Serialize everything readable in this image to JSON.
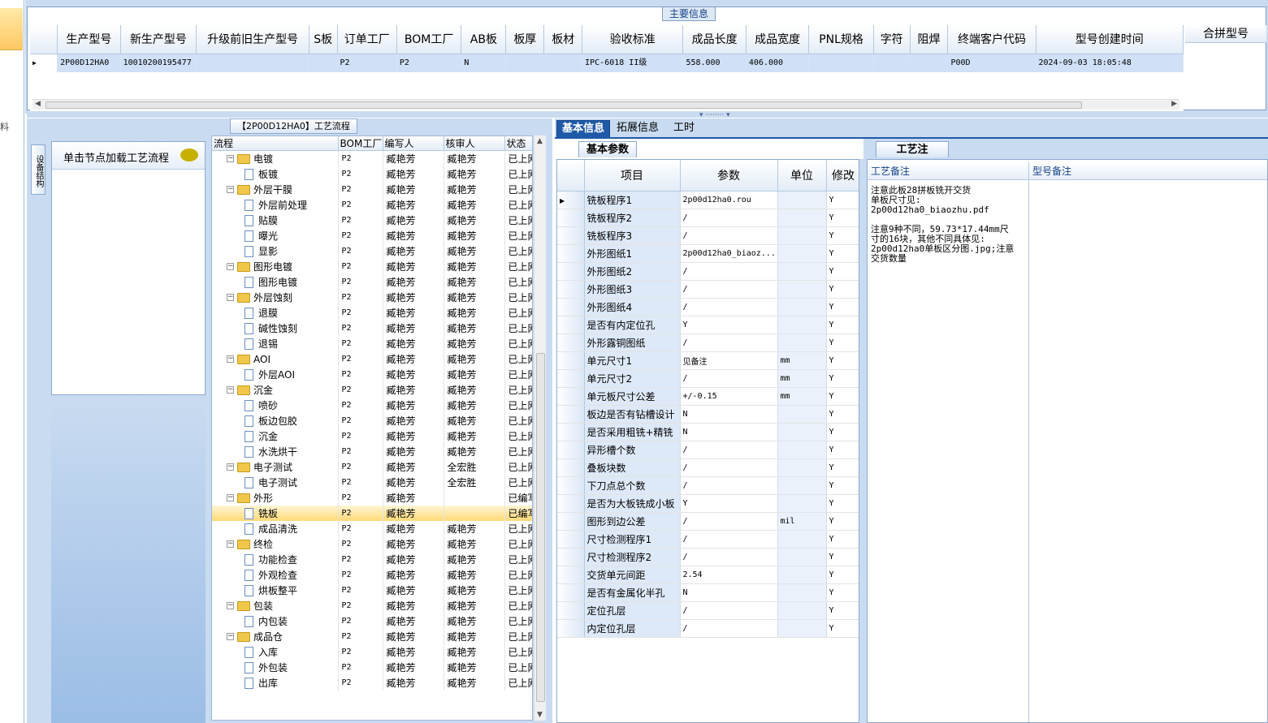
{
  "main_info": {
    "title": "主要信息",
    "columns": [
      "生产型号",
      "新生产型号",
      "升级前旧生产型号",
      "S板",
      "订单工厂",
      "BOM工厂",
      "AB板",
      "板厚",
      "板材",
      "验收标准",
      "成品长度",
      "成品宽度",
      "PNL规格",
      "字符",
      "阻焊",
      "终端客户代码",
      "型号创建时间"
    ],
    "row": [
      "2P00D12HA0",
      "10010200195477",
      "",
      "",
      "P2",
      "P2",
      "N",
      "",
      "",
      "IPC-6018 II级",
      "558.000",
      "406.000",
      "",
      "",
      "",
      "P00D",
      "2024-09-03 18:05:48"
    ],
    "merge_header": "合拼型号"
  },
  "left_strip": {
    "char": "料"
  },
  "side": {
    "vtab_label": "设备结构",
    "hint": "单击节点加载工艺流程"
  },
  "tree": {
    "title": "【2P00D12HA0】工艺流程",
    "columns": [
      "流程",
      "BOM工厂",
      "编写人",
      "核审人",
      "状态"
    ],
    "rows": [
      {
        "level": 0,
        "name": "电镀",
        "bom": "P2",
        "writer": "臧艳芳",
        "reviewer": "臧艳芳",
        "status": "已上网"
      },
      {
        "level": 1,
        "name": "板镀",
        "bom": "P2",
        "writer": "臧艳芳",
        "reviewer": "臧艳芳",
        "status": "已上网"
      },
      {
        "level": 0,
        "name": "外层干膜",
        "bom": "P2",
        "writer": "臧艳芳",
        "reviewer": "臧艳芳",
        "status": "已上网"
      },
      {
        "level": 1,
        "name": "外层前处理",
        "bom": "P2",
        "writer": "臧艳芳",
        "reviewer": "臧艳芳",
        "status": "已上网"
      },
      {
        "level": 1,
        "name": "贴膜",
        "bom": "P2",
        "writer": "臧艳芳",
        "reviewer": "臧艳芳",
        "status": "已上网"
      },
      {
        "level": 1,
        "name": "曝光",
        "bom": "P2",
        "writer": "臧艳芳",
        "reviewer": "臧艳芳",
        "status": "已上网"
      },
      {
        "level": 1,
        "name": "显影",
        "bom": "P2",
        "writer": "臧艳芳",
        "reviewer": "臧艳芳",
        "status": "已上网"
      },
      {
        "level": 0,
        "name": "图形电镀",
        "bom": "P2",
        "writer": "臧艳芳",
        "reviewer": "臧艳芳",
        "status": "已上网"
      },
      {
        "level": 1,
        "name": "图形电镀",
        "bom": "P2",
        "writer": "臧艳芳",
        "reviewer": "臧艳芳",
        "status": "已上网"
      },
      {
        "level": 0,
        "name": "外层蚀刻",
        "bom": "P2",
        "writer": "臧艳芳",
        "reviewer": "臧艳芳",
        "status": "已上网"
      },
      {
        "level": 1,
        "name": "退膜",
        "bom": "P2",
        "writer": "臧艳芳",
        "reviewer": "臧艳芳",
        "status": "已上网"
      },
      {
        "level": 1,
        "name": "碱性蚀刻",
        "bom": "P2",
        "writer": "臧艳芳",
        "reviewer": "臧艳芳",
        "status": "已上网"
      },
      {
        "level": 1,
        "name": "退锡",
        "bom": "P2",
        "writer": "臧艳芳",
        "reviewer": "臧艳芳",
        "status": "已上网"
      },
      {
        "level": 0,
        "name": "AOI",
        "bom": "P2",
        "writer": "臧艳芳",
        "reviewer": "臧艳芳",
        "status": "已上网"
      },
      {
        "level": 1,
        "name": "外层AOI",
        "bom": "P2",
        "writer": "臧艳芳",
        "reviewer": "臧艳芳",
        "status": "已上网"
      },
      {
        "level": 0,
        "name": "沉金",
        "bom": "P2",
        "writer": "臧艳芳",
        "reviewer": "臧艳芳",
        "status": "已上网"
      },
      {
        "level": 1,
        "name": "喷砂",
        "bom": "P2",
        "writer": "臧艳芳",
        "reviewer": "臧艳芳",
        "status": "已上网"
      },
      {
        "level": 1,
        "name": "板边包胶",
        "bom": "P2",
        "writer": "臧艳芳",
        "reviewer": "臧艳芳",
        "status": "已上网"
      },
      {
        "level": 1,
        "name": "沉金",
        "bom": "P2",
        "writer": "臧艳芳",
        "reviewer": "臧艳芳",
        "status": "已上网"
      },
      {
        "level": 1,
        "name": "水洗烘干",
        "bom": "P2",
        "writer": "臧艳芳",
        "reviewer": "臧艳芳",
        "status": "已上网"
      },
      {
        "level": 0,
        "name": "电子测试",
        "bom": "P2",
        "writer": "臧艳芳",
        "reviewer": "全宏胜",
        "status": "已上网"
      },
      {
        "level": 1,
        "name": "电子测试",
        "bom": "P2",
        "writer": "臧艳芳",
        "reviewer": "全宏胜",
        "status": "已上网"
      },
      {
        "level": 0,
        "name": "外形",
        "bom": "P2",
        "writer": "臧艳芳",
        "reviewer": "",
        "status": "已编写"
      },
      {
        "level": 1,
        "name": "铣板",
        "bom": "P2",
        "writer": "臧艳芳",
        "reviewer": "",
        "status": "已编写",
        "selected": true
      },
      {
        "level": 1,
        "name": "成品清洗",
        "bom": "P2",
        "writer": "臧艳芳",
        "reviewer": "臧艳芳",
        "status": "已上网"
      },
      {
        "level": 0,
        "name": "终检",
        "bom": "P2",
        "writer": "臧艳芳",
        "reviewer": "臧艳芳",
        "status": "已上网"
      },
      {
        "level": 1,
        "name": "功能检查",
        "bom": "P2",
        "writer": "臧艳芳",
        "reviewer": "臧艳芳",
        "status": "已上网"
      },
      {
        "level": 1,
        "name": "外观检查",
        "bom": "P2",
        "writer": "臧艳芳",
        "reviewer": "臧艳芳",
        "status": "已上网"
      },
      {
        "level": 1,
        "name": "烘板整平",
        "bom": "P2",
        "writer": "臧艳芳",
        "reviewer": "臧艳芳",
        "status": "已上网"
      },
      {
        "level": 0,
        "name": "包装",
        "bom": "P2",
        "writer": "臧艳芳",
        "reviewer": "臧艳芳",
        "status": "已上网"
      },
      {
        "level": 1,
        "name": "内包装",
        "bom": "P2",
        "writer": "臧艳芳",
        "reviewer": "臧艳芳",
        "status": "已上网"
      },
      {
        "level": 0,
        "name": "成品仓",
        "bom": "P2",
        "writer": "臧艳芳",
        "reviewer": "臧艳芳",
        "status": "已上网"
      },
      {
        "level": 1,
        "name": "入库",
        "bom": "P2",
        "writer": "臧艳芳",
        "reviewer": "臧艳芳",
        "status": "已上网"
      },
      {
        "level": 1,
        "name": "外包装",
        "bom": "P2",
        "writer": "臧艳芳",
        "reviewer": "臧艳芳",
        "status": "已上网"
      },
      {
        "level": 1,
        "name": "出库",
        "bom": "P2",
        "writer": "臧艳芳",
        "reviewer": "臧艳芳",
        "status": "已上网"
      }
    ]
  },
  "tabs": [
    "基本信息",
    "拓展信息",
    "工时"
  ],
  "params": {
    "subtab": "基本参数",
    "columns": [
      "项目",
      "参数",
      "单位",
      "修改"
    ],
    "rows": [
      {
        "item": "铣板程序1",
        "value": "2p00d12ha0.rou",
        "unit": "",
        "mod": "Y"
      },
      {
        "item": "铣板程序2",
        "value": "/",
        "unit": "",
        "mod": "Y"
      },
      {
        "item": "铣板程序3",
        "value": "/",
        "unit": "",
        "mod": "Y"
      },
      {
        "item": "外形图纸1",
        "value": "2p00d12ha0_biaoz...",
        "unit": "",
        "mod": "Y"
      },
      {
        "item": "外形图纸2",
        "value": "/",
        "unit": "",
        "mod": "Y"
      },
      {
        "item": "外形图纸3",
        "value": "/",
        "unit": "",
        "mod": "Y"
      },
      {
        "item": "外形图纸4",
        "value": "/",
        "unit": "",
        "mod": "Y"
      },
      {
        "item": "是否有内定位孔",
        "value": "Y",
        "unit": "",
        "mod": "Y"
      },
      {
        "item": "外形露铜图纸",
        "value": "/",
        "unit": "",
        "mod": "Y"
      },
      {
        "item": "单元尺寸1",
        "value": "见备注",
        "unit": "mm",
        "mod": "Y"
      },
      {
        "item": "单元尺寸2",
        "value": "/",
        "unit": "mm",
        "mod": "Y"
      },
      {
        "item": "单元板尺寸公差",
        "value": "+/-0.15",
        "unit": "mm",
        "mod": "Y"
      },
      {
        "item": "板边是否有钻槽设计",
        "value": "N",
        "unit": "",
        "mod": "Y"
      },
      {
        "item": "是否采用粗铣+精铣",
        "value": "N",
        "unit": "",
        "mod": "Y"
      },
      {
        "item": "异形槽个数",
        "value": "/",
        "unit": "",
        "mod": "Y"
      },
      {
        "item": "叠板块数",
        "value": "/",
        "unit": "",
        "mod": "Y"
      },
      {
        "item": "下刀点总个数",
        "value": "/",
        "unit": "",
        "mod": "Y"
      },
      {
        "item": "是否为大板铣成小板",
        "value": "Y",
        "unit": "",
        "mod": "Y"
      },
      {
        "item": "图形到边公差",
        "value": "/",
        "unit": "mil",
        "mod": "Y"
      },
      {
        "item": "尺寸检测程序1",
        "value": "/",
        "unit": "",
        "mod": "Y"
      },
      {
        "item": "尺寸检测程序2",
        "value": "/",
        "unit": "",
        "mod": "Y"
      },
      {
        "item": "交货单元间距",
        "value": "2.54",
        "unit": "",
        "mod": "Y"
      },
      {
        "item": "是否有金属化半孔",
        "value": "N",
        "unit": "",
        "mod": "Y"
      },
      {
        "item": "定位孔层",
        "value": "/",
        "unit": "",
        "mod": "Y"
      },
      {
        "item": "内定位孔层",
        "value": "/",
        "unit": "",
        "mod": "Y"
      }
    ]
  },
  "notes": {
    "tab": "工艺注",
    "col1": "工艺备注",
    "col2": "型号备注",
    "text": "注意此板28拼板铣开交货\n单板尺寸见:\n2p00d12ha0_biaozhu.pdf\n\n注意9种不同，59.73*17.44mm尺寸的16块，其他不同具体见:\n2p00d12ha0单板区分图.jpg;注意交货数量"
  }
}
